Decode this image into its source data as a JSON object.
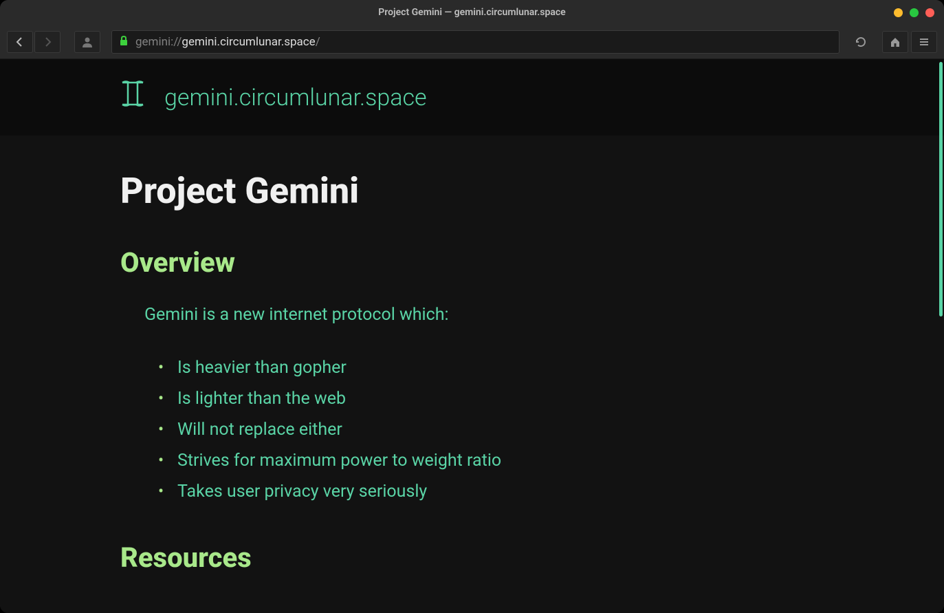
{
  "window": {
    "title": "Project Gemini — gemini.circumlunar.space"
  },
  "urlbar": {
    "scheme": "gemini://",
    "host": "gemini.circumlunar.space",
    "path": "/"
  },
  "page": {
    "hostname": "gemini.circumlunar.space",
    "title": "Project Gemini",
    "sections": {
      "overview": {
        "heading": "Overview",
        "intro": "Gemini is a new internet protocol which:",
        "bullets": [
          "Is heavier than gopher",
          "Is lighter than the web",
          "Will not replace either",
          "Strives for maximum power to weight ratio",
          "Takes user privacy very seriously"
        ]
      },
      "resources": {
        "heading": "Resources"
      }
    }
  },
  "colors": {
    "accent_teal": "#5ad4a6",
    "accent_green": "#a8e88a",
    "bg_dark": "#121212",
    "bg_header": "#0c0c0c"
  }
}
